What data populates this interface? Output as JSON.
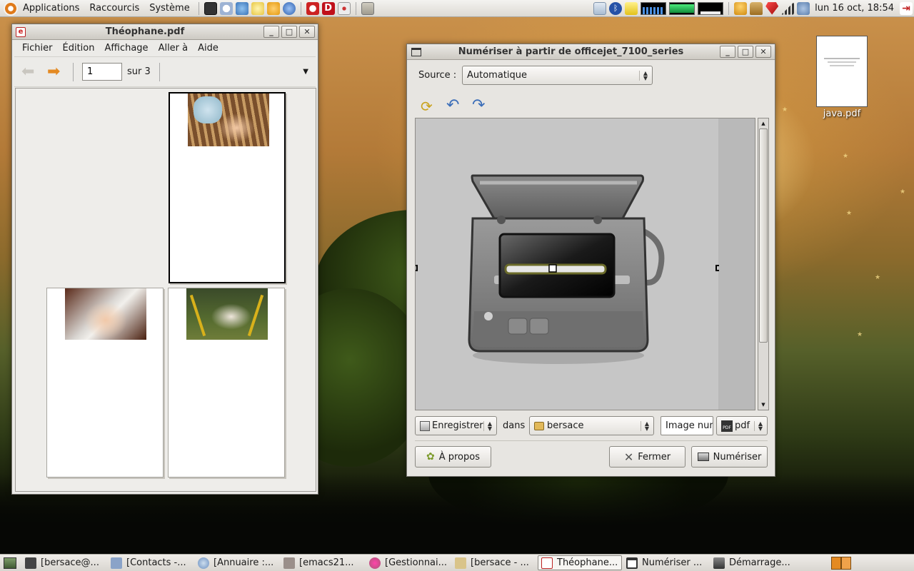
{
  "top_panel": {
    "menus": [
      "Applications",
      "Raccourcis",
      "Système"
    ],
    "clock": "lun 16 oct, 18:54"
  },
  "evince": {
    "title": "Théophane.pdf",
    "menu": [
      "Fichier",
      "Édition",
      "Affichage",
      "Aller à",
      "Aide"
    ],
    "page_value": "1",
    "page_of": "sur 3"
  },
  "scanner": {
    "title": "Numériser à partir de officejet_7100_series",
    "source_label": "Source :",
    "source_value": "Automatique",
    "save_label": "Enregistrer",
    "in_label": "dans",
    "folder": "bersace",
    "filename": "Image nun",
    "format": "pdf",
    "about": "À propos",
    "close": "Fermer",
    "scan": "Numériser"
  },
  "desktop": {
    "file_label": "java.pdf"
  },
  "taskbar": {
    "tasks": [
      {
        "label": "[bersace@..."
      },
      {
        "label": "[Contacts -..."
      },
      {
        "label": "[Annuaire :..."
      },
      {
        "label": "[emacs21..."
      },
      {
        "label": "[Gestionnai..."
      },
      {
        "label": "[bersace - ..."
      },
      {
        "label": "Théophane..."
      },
      {
        "label": "Numériser ..."
      },
      {
        "label": "Démarrage..."
      }
    ]
  },
  "colors": {
    "panel_bg": "#dcd9d3",
    "window_bg": "#ecebe8",
    "accent_orange": "#e48a22"
  }
}
